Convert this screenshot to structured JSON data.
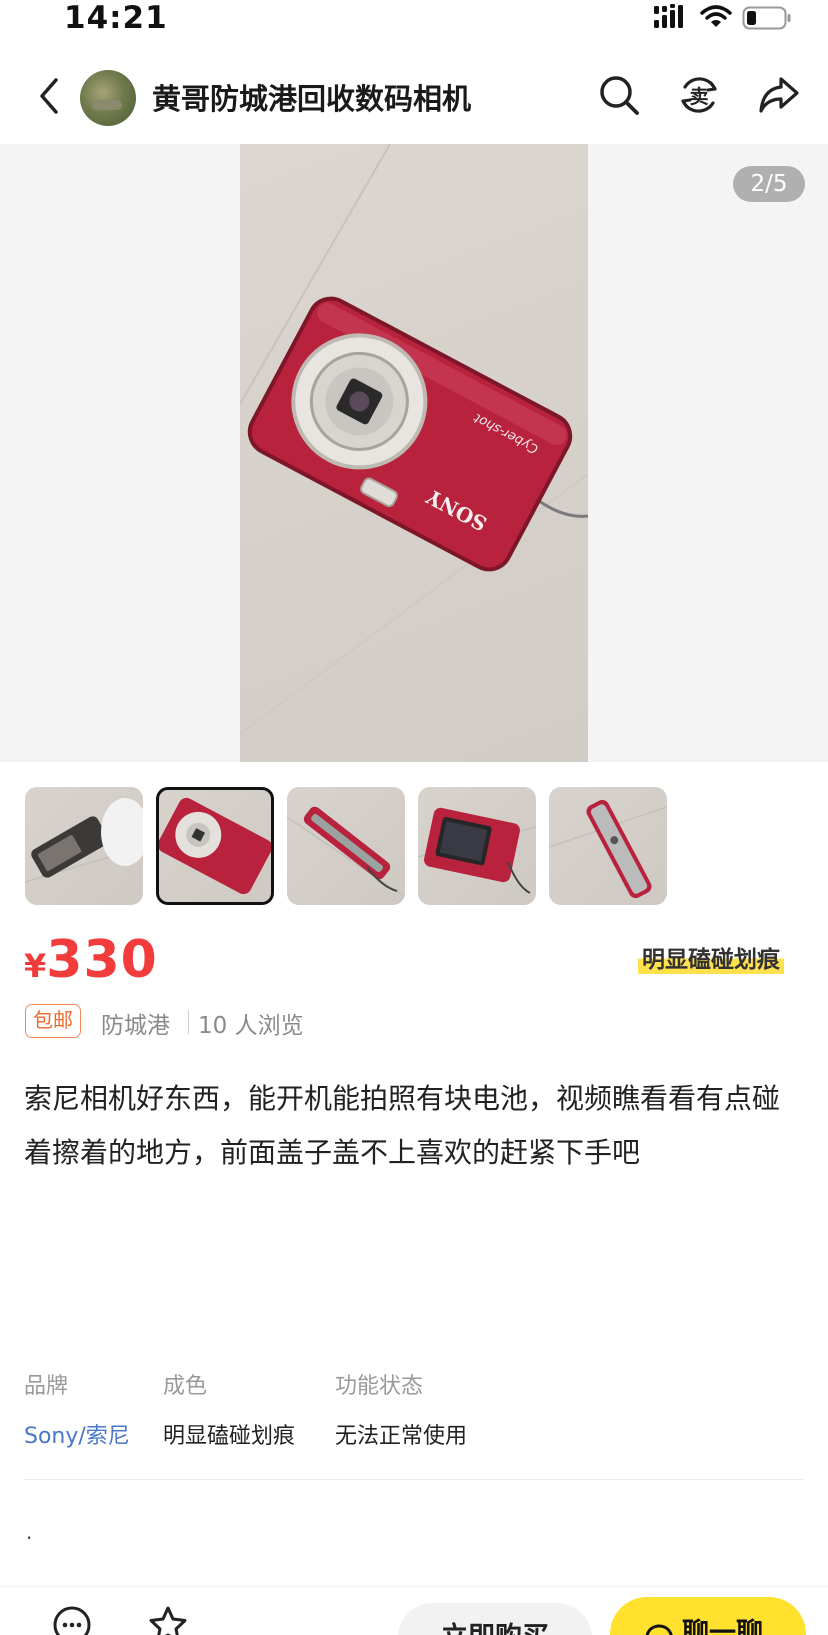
{
  "status_bar": {
    "time": "14:21"
  },
  "nav": {
    "seller_name": "黄哥防城港回收数码相机",
    "icons": [
      "back-icon",
      "search-icon",
      "sell-icon",
      "share-icon"
    ],
    "sell_glyph": "卖"
  },
  "gallery": {
    "page_indicator": "2/5",
    "current": 2,
    "total": 5,
    "camera_brand_text": "SONY",
    "camera_model_text": "Cyber-shot"
  },
  "price": {
    "currency": "¥",
    "amount": "330"
  },
  "condition_tag": "明显磕碰划痕",
  "meta": {
    "shipping_badge": "包邮",
    "location": "防城港",
    "views": "10 人浏览"
  },
  "description": "索尼相机好东西，能开机能拍照有块电池，视频瞧看看有点碰着擦着的地方，前面盖子盖不上喜欢的赶紧下手吧",
  "attributes": [
    {
      "label": "品牌",
      "value": "Sony/索尼"
    },
    {
      "label": "成色",
      "value": "明显磕碰划痕"
    },
    {
      "label": "功能状态",
      "value": "无法正常使用"
    }
  ],
  "footer_dot": ".",
  "bottom_bar": {
    "buy_label": "立即购买",
    "chat_label": "聊一聊"
  },
  "colors": {
    "price": "#f23b3b",
    "accent_yellow": "#ffe12e",
    "brand_link": "#4a78c9",
    "camera_body": "#b8223d"
  }
}
